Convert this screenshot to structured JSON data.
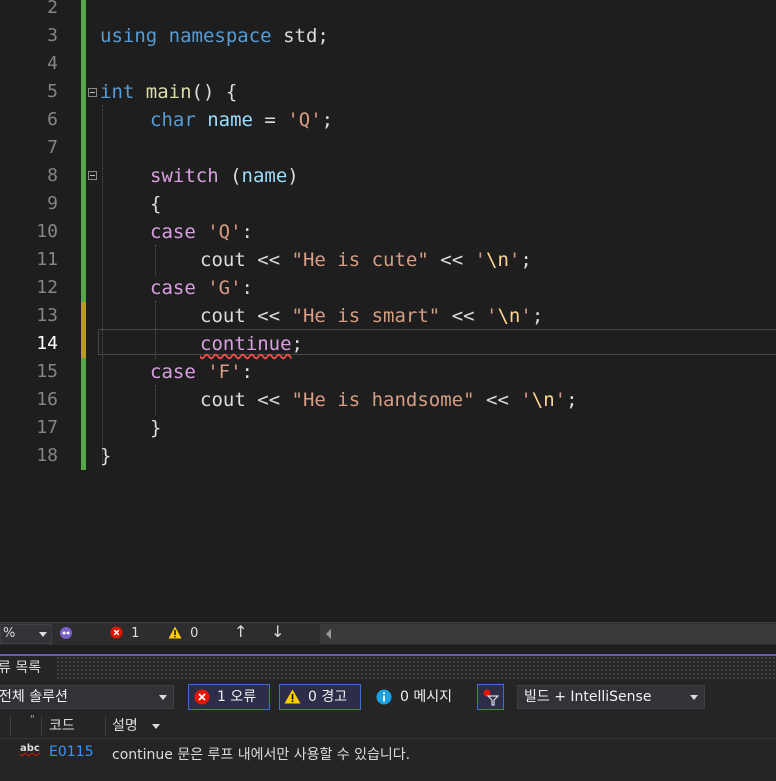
{
  "editor": {
    "lines": [
      {
        "n": "2"
      },
      {
        "n": "3"
      },
      {
        "n": "4"
      },
      {
        "n": "5"
      },
      {
        "n": "6"
      },
      {
        "n": "7"
      },
      {
        "n": "8"
      },
      {
        "n": "9"
      },
      {
        "n": "10"
      },
      {
        "n": "11"
      },
      {
        "n": "12"
      },
      {
        "n": "13"
      },
      {
        "n": "14"
      },
      {
        "n": "15"
      },
      {
        "n": "16"
      },
      {
        "n": "17"
      },
      {
        "n": "18"
      }
    ],
    "code": {
      "l3": {
        "using": "using",
        "namespace": "namespace",
        "std": "std;"
      },
      "l5": {
        "int": "int",
        "main": "main",
        "rest": "() {"
      },
      "l6": {
        "char": "char",
        "name": "name",
        "eq": " = ",
        "q": "'Q'",
        "semi": ";"
      },
      "l8": {
        "switch": "switch",
        "open": " (",
        "name": "name",
        "close": ")"
      },
      "l9": {
        "brace": "{"
      },
      "l10": {
        "case": "case",
        "lit": "'Q'",
        "colon": ":"
      },
      "l11": {
        "cout": "cout",
        "op1": " << ",
        "s": "\"He is cute\"",
        "op2": " << ",
        "c1": "'",
        "esc": "\\n",
        "c2": "'",
        "semi": ";"
      },
      "l12": {
        "case": "case",
        "lit": "'G'",
        "colon": ":"
      },
      "l13": {
        "cout": "cout",
        "op1": " << ",
        "s": "\"He is smart\"",
        "op2": " << ",
        "c1": "'",
        "esc": "\\n",
        "c2": "'",
        "semi": ";"
      },
      "l14": {
        "kw": "continue",
        "semi": ";"
      },
      "l15": {
        "case": "case",
        "lit": "'F'",
        "colon": ":"
      },
      "l16": {
        "cout": "cout",
        "op1": " << ",
        "s": "\"He is handsome\"",
        "op2": " << ",
        "c1": "'",
        "esc": "\\n",
        "c2": "'",
        "semi": ";"
      },
      "l17": {
        "brace": "}"
      },
      "l18": {
        "brace": "}"
      }
    }
  },
  "statusbar": {
    "zoom": "%",
    "errors": "1",
    "warnings": "0"
  },
  "panel": {
    "title": "류 목록",
    "scope": "전체 솔루션",
    "errors_btn": "1 오류",
    "warnings_btn": "0 경고",
    "messages_btn": "0 메시지",
    "source_filter": "빌드 + IntelliSense",
    "columns": {
      "code": "코드",
      "desc": "설명"
    },
    "row": {
      "code": "E0115",
      "desc": "continue 문은 루프 내에서만 사용할 수 있습니다."
    }
  },
  "colors": {
    "accent": "#6e5ab8",
    "error": "#e51400",
    "warning": "#ffcc00",
    "info": "#1ba1e2"
  }
}
